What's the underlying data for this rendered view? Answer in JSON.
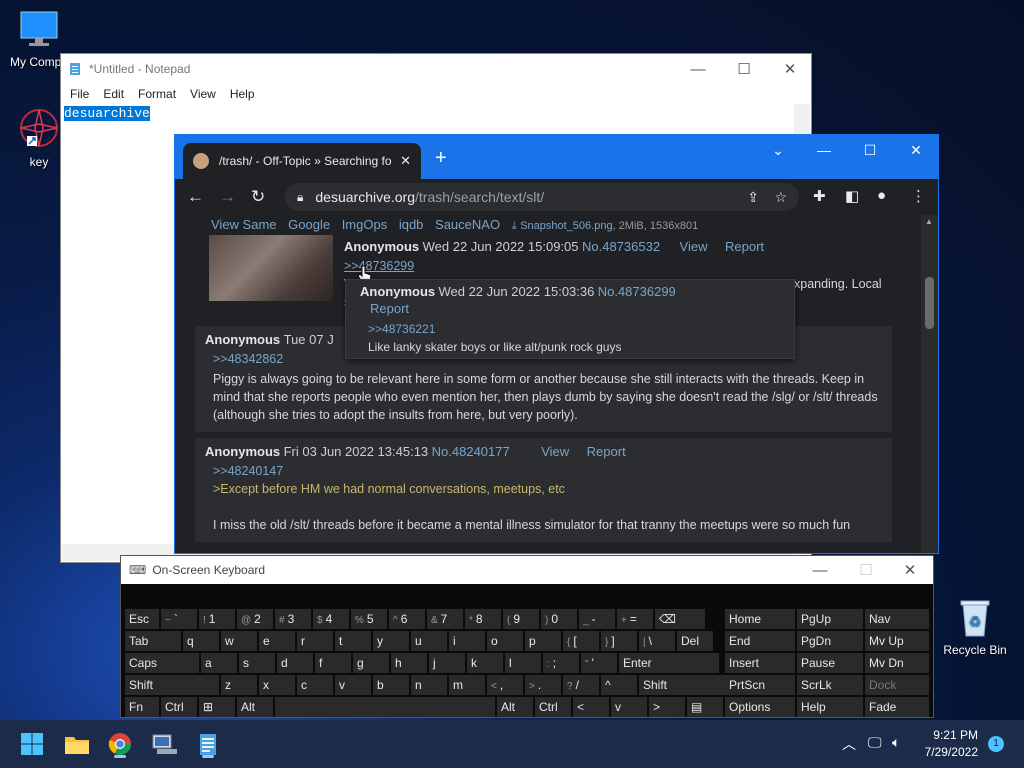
{
  "desktop": {
    "icons": [
      {
        "label": "My Compu"
      },
      {
        "label": "key"
      },
      {
        "label": "Recycle Bin"
      }
    ]
  },
  "notepad": {
    "title": "*Untitled - Notepad",
    "menu": [
      "File",
      "Edit",
      "Format",
      "View",
      "Help"
    ],
    "selected_text": "desuarchive"
  },
  "chrome": {
    "tab_title": "/trash/ - Off-Topic » Searching fo",
    "url_host": "desuarchive.org",
    "url_path": "/trash/search/text/slt/",
    "image_links": [
      "View Same",
      "Google",
      "ImgOps",
      "iqdb",
      "SauceNAO"
    ],
    "file_name": "Snapshot_506.png",
    "file_meta": ", 2MiB, 1536x801",
    "post1": {
      "name": "Anonymous",
      "date": "Wed 22 Jun 2022 15:09:05",
      "no": "No.48736532",
      "view": "View",
      "report": "Report",
      "ref": ">>48736299",
      "frag_v": "V",
      "frag_s": "s",
      "trail": "xpanding. Local"
    },
    "hover": {
      "name": "Anonymous",
      "date": "Wed 22 Jun 2022 15:03:36",
      "no": "No.48736299",
      "report": "Report",
      "ref": ">>48736221",
      "text": "Like lanky skater boys or like alt/punk rock guys"
    },
    "post2": {
      "name": "Anonymous",
      "date": "Tue 07 J",
      "ref": ">>48342862",
      "text": "Piggy is always going to be relevant here in some form or another because she still interacts with the threads. Keep in mind that she reports people who even mention her, then plays dumb by saying she doesn't read the /slg/ or /slt/ threads (although she tries to adopt the insults from here, but very poorly)."
    },
    "post3": {
      "name": "Anonymous",
      "date": "Fri 03 Jun 2022 13:45:13",
      "no": "No.48240177",
      "view": "View",
      "report": "Report",
      "ref": ">>48240147",
      "quote": ">Except before HM we had normal conversations, meetups, etc",
      "text": "I miss the old /slt/ threads before it became a mental illness simulator for that tranny the meetups were so much fun"
    }
  },
  "osk": {
    "title": "On-Screen Keyboard",
    "row1": [
      {
        "m": "Esc"
      },
      {
        "s": "~",
        "m": "`"
      },
      {
        "s": "!",
        "m": "1"
      },
      {
        "s": "@",
        "m": "2"
      },
      {
        "s": "#",
        "m": "3"
      },
      {
        "s": "$",
        "m": "4"
      },
      {
        "s": "%",
        "m": "5"
      },
      {
        "s": "^",
        "m": "6"
      },
      {
        "s": "&",
        "m": "7"
      },
      {
        "s": "*",
        "m": "8"
      },
      {
        "s": "(",
        "m": "9"
      },
      {
        "s": ")",
        "m": "0"
      },
      {
        "s": "_",
        "m": "-"
      },
      {
        "s": "+",
        "m": "="
      },
      {
        "m": "⌫"
      }
    ],
    "row2": [
      {
        "m": "Tab"
      },
      {
        "m": "q"
      },
      {
        "m": "w"
      },
      {
        "m": "e"
      },
      {
        "m": "r"
      },
      {
        "m": "t"
      },
      {
        "m": "y"
      },
      {
        "m": "u"
      },
      {
        "m": "i"
      },
      {
        "m": "o"
      },
      {
        "m": "p"
      },
      {
        "s": "{",
        "m": "["
      },
      {
        "s": "}",
        "m": "]"
      },
      {
        "s": "|",
        "m": "\\"
      },
      {
        "m": "Del"
      }
    ],
    "row3": [
      {
        "m": "Caps"
      },
      {
        "m": "a"
      },
      {
        "m": "s"
      },
      {
        "m": "d"
      },
      {
        "m": "f"
      },
      {
        "m": "g"
      },
      {
        "m": "h"
      },
      {
        "m": "j"
      },
      {
        "m": "k"
      },
      {
        "m": "l"
      },
      {
        "s": ":",
        "m": ";"
      },
      {
        "s": "\"",
        "m": "'"
      },
      {
        "m": "Enter"
      }
    ],
    "row4": [
      {
        "m": "Shift"
      },
      {
        "m": "z"
      },
      {
        "m": "x"
      },
      {
        "m": "c"
      },
      {
        "m": "v"
      },
      {
        "m": "b"
      },
      {
        "m": "n"
      },
      {
        "m": "m"
      },
      {
        "s": "<",
        "m": ","
      },
      {
        "s": ">",
        "m": "."
      },
      {
        "s": "?",
        "m": "/"
      },
      {
        "m": "^"
      },
      {
        "m": "Shift"
      }
    ],
    "row5": [
      {
        "m": "Fn"
      },
      {
        "m": "Ctrl"
      },
      {
        "m": "⊞"
      },
      {
        "m": "Alt"
      },
      {
        "m": ""
      },
      {
        "m": "Alt"
      },
      {
        "m": "Ctrl"
      },
      {
        "m": "<"
      },
      {
        "m": "v"
      },
      {
        "m": ">"
      },
      {
        "m": "▤"
      }
    ],
    "nav": [
      [
        "Home",
        "PgUp",
        "Nav"
      ],
      [
        "End",
        "PgDn",
        "Mv Up"
      ],
      [
        "Insert",
        "Pause",
        "Mv Dn"
      ],
      [
        "PrtScn",
        "ScrLk",
        "Dock"
      ],
      [
        "Options",
        "Help",
        "Fade"
      ]
    ]
  },
  "taskbar": {
    "time": "9:21 PM",
    "date": "7/29/2022",
    "notifications": "1"
  },
  "colors": {
    "chrome_accent": "#1a73e8",
    "link": "#7aa4c9",
    "quote": "#c8b86b"
  }
}
